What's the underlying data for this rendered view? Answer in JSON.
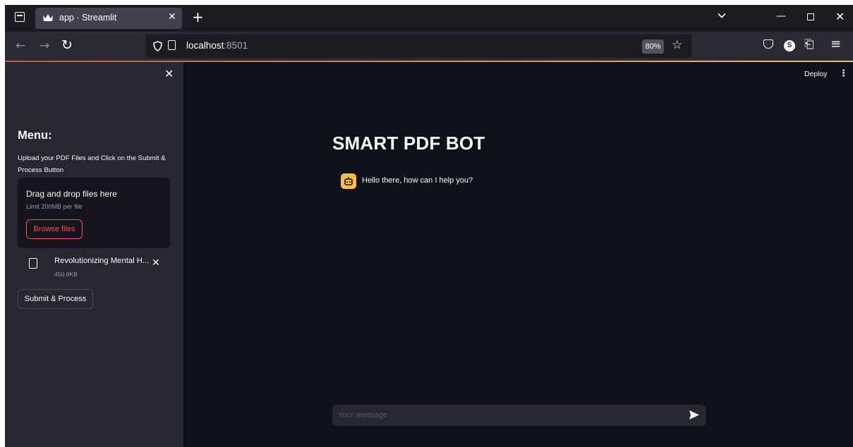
{
  "browser": {
    "tab_title": "app · Streamlit",
    "tab_close": "✕",
    "new_tab": "+",
    "url_host": "localhost",
    "url_port": ":8501",
    "zoom": "80%",
    "accent_colors": [
      "#e64a2e",
      "#f5c33b"
    ]
  },
  "sidebar": {
    "close": "✕",
    "menu_title": "Menu:",
    "description": "Upload your PDF Files and Click on the Submit & Process Button",
    "uploader": {
      "title": "Drag and drop files here",
      "limit": "Limit 200MB per file",
      "browse_label": "Browse files"
    },
    "file": {
      "name": "Revolutionizing Mental H...",
      "size": "450.6KB",
      "remove": "✕"
    },
    "submit_label": "Submit & Process"
  },
  "header": {
    "deploy_label": "Deploy",
    "menu": "⋮"
  },
  "main": {
    "title": "SMART PDF BOT",
    "messages": [
      {
        "role": "assistant",
        "avatar_icon": "bot-icon",
        "text": "Hello there, how can I help you?"
      }
    ],
    "input_placeholder": "Your message"
  },
  "colors": {
    "app_bg": "#0e1117",
    "sidebar_bg": "#262730",
    "primary": "#ff4b4b",
    "avatar_bg": "#ffbd45"
  }
}
